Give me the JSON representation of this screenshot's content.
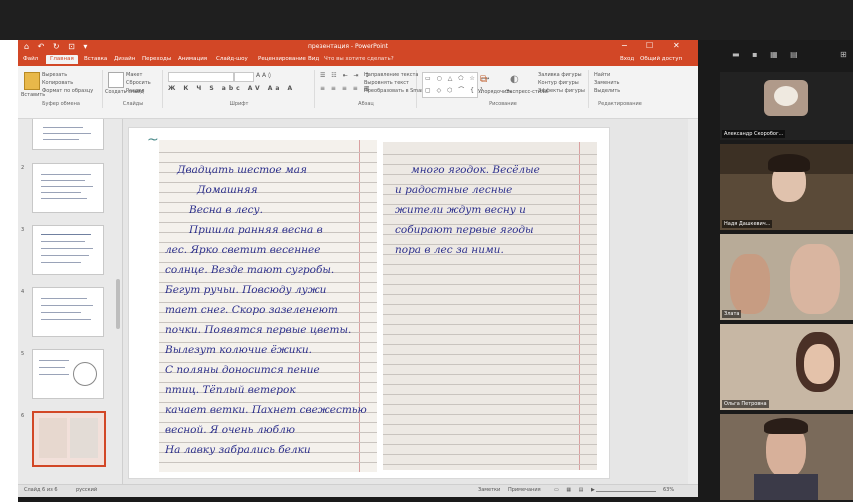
{
  "powerpoint": {
    "title": "презентация - PowerPoint",
    "quick_access": "⌂ ↶ ↻ ⊡ ▾",
    "window_controls": [
      "−",
      "☐",
      "✕"
    ],
    "tabs": [
      {
        "label": "Файл"
      },
      {
        "label": "Главная"
      },
      {
        "label": "Вставка"
      },
      {
        "label": "Дизайн"
      },
      {
        "label": "Переходы"
      },
      {
        "label": "Анимация"
      },
      {
        "label": "Слайд-шоу"
      },
      {
        "label": "Рецензирование"
      },
      {
        "label": "Вид"
      },
      {
        "label": "Что вы хотите сделать?"
      },
      {
        "label": "Вход"
      },
      {
        "label": "Общий доступ"
      }
    ],
    "ribbon_groups": [
      "Буфер обмена",
      "Слайды",
      "Шрифт",
      "Абзац",
      "Рисование",
      "Редактирование"
    ],
    "ribbon_items": {
      "paste": "Вставить",
      "cut": "Вырезать",
      "copy": "Копировать",
      "format_painter": "Формат по образцу",
      "new_slide": "Создать слайд",
      "layout": "Макет",
      "reset": "Сбросить",
      "section": "Раздел",
      "text_direction": "Направление текста",
      "align_text": "Выровнять текст",
      "smartart": "Преобразовать в SmartArt",
      "arrange": "Упорядочить",
      "quick_styles": "Экспресс-стили",
      "shape_fill": "Заливка фигуры",
      "shape_outline": "Контур фигуры",
      "shape_effects": "Эффекты фигуры",
      "find": "Найти",
      "replace": "Заменить",
      "select": "Выделить"
    },
    "slide_numbers": [
      "",
      "2",
      "3",
      "4",
      "5",
      "6"
    ],
    "status": {
      "slide": "Слайд 6 из 6",
      "language": "русский",
      "notes": "Заметки",
      "comments": "Примечания",
      "zoom": "63%"
    }
  },
  "notebook": {
    "left_lines": [
      "Двадцать шестое мая",
      "Домашняя",
      "Весна в лесу.",
      "Пришла ранняя весна в",
      "лес. Ярко светит весеннее",
      "солнце. Везде тают сугробы.",
      "Бегут ручьи. Повсюду лужи",
      "тает снег. Скоро зазеленеют",
      "почки. Появятся первые цветы.",
      "Вылезут колючие ёжики.",
      "С поляны доносится пение",
      "птиц. Тёплый ветерок",
      "качает ветки. Пахнет свежестью",
      "весной. Я очень люблю",
      "На лавку забрались белки"
    ],
    "right_lines": [
      "много ягодок. Весёлые",
      "и радостные лесные",
      "жители ждут весну и",
      "собирают первые ягоды",
      "пора в лес за ними."
    ]
  },
  "zoom": {
    "toolbar_icons": "▬ ▪ ▦ ▤",
    "participants": [
      {
        "name": "Александр Скоробог..."
      },
      {
        "name": "Надя Дашкевич..."
      },
      {
        "name": "Злата"
      },
      {
        "name": "Ольга Петровна"
      },
      {
        "name": ""
      }
    ]
  }
}
